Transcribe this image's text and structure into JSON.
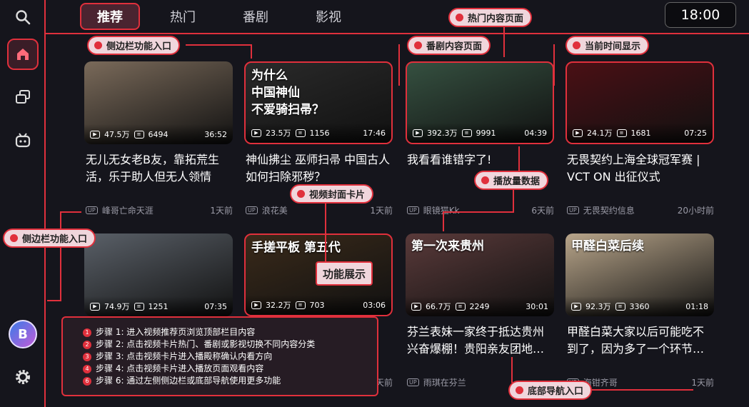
{
  "tabs": [
    "推荐",
    "热门",
    "番剧",
    "影视"
  ],
  "clock": "18:00",
  "sidebar": {
    "icons": [
      "search-icon",
      "home-icon",
      "library-icon",
      "tv-icon",
      "settings-icon"
    ],
    "avatar_letter": "B"
  },
  "cards": [
    {
      "views": "47.5万",
      "danmaku": "6494",
      "duration": "36:52",
      "title": "无儿无女老B友，靠拓荒生活，乐于助人但无人领情",
      "up": "UP",
      "author": "峰哥亡命天涯",
      "time": "1天前",
      "overlay": "",
      "thumb_color": "#7a6a5a"
    },
    {
      "views": "23.5万",
      "danmaku": "1156",
      "duration": "17:46",
      "title": "神仙拂尘 巫师扫帚 中国古人如何扫除邪秽？",
      "up": "UP",
      "author": "浪花美",
      "time": "1天前",
      "overlay": "为什么\n中国神仙\n不爱骑扫帚？",
      "thumb_color": "#2a2a2a"
    },
    {
      "views": "392.3万",
      "danmaku": "9991",
      "duration": "04:39",
      "title": "我看看谁错字了!",
      "up": "UP",
      "author": "眼镜猫Kk",
      "time": "6天前",
      "overlay": "",
      "thumb_color": "#355040"
    },
    {
      "views": "24.1万",
      "danmaku": "1681",
      "duration": "07:25",
      "title": "无畏契约上海全球冠军赛 | VCT ON 出征仪式",
      "up": "UP",
      "author": "无畏契约信息",
      "time": "20小时前",
      "overlay": "",
      "thumb_color": "#4a1015"
    },
    {
      "views": "74.9万",
      "danmaku": "1251",
      "duration": "07:35",
      "title": "",
      "up": "UP",
      "author": "",
      "time": "",
      "overlay": "",
      "thumb_color": "#5a6068"
    },
    {
      "views": "32.2万",
      "danmaku": "703",
      "duration": "03:06",
      "title": "",
      "up": "UP",
      "author": "",
      "time": "1天前",
      "overlay": "手搓平板 第五代",
      "thumb_color": "#3a2a1a"
    },
    {
      "views": "66.7万",
      "danmaku": "2249",
      "duration": "30:01",
      "title": "芬兰表妹一家终于抵达贵州兴奋爆棚！贵阳亲友团地…",
      "up": "UP",
      "author": "雨琪在芬兰",
      "time": "",
      "overlay": "第一次来贵州",
      "thumb_color": "#5a3a3a"
    },
    {
      "views": "92.3万",
      "danmaku": "3360",
      "duration": "01:18",
      "title": "甲醛白菜大家以后可能吃不到了，因为多了一个环节…",
      "up": "UP",
      "author": "海钳齐哥",
      "time": "1天前",
      "overlay": "甲醛白菜后续",
      "thumb_color": "#b8a58a"
    }
  ],
  "callouts": {
    "sidebar_entry_top": "侧边栏功能入口",
    "sidebar_entry_left": "侧边栏功能入口",
    "hot_page": "热门内容页面",
    "anime_page": "番剧内容页面",
    "current_time": "当前时间显示",
    "play_count": "播放量数据",
    "cover_card": "视频封面卡片",
    "bottom_nav": "底部导航入口",
    "feature_demo": "功能展示"
  },
  "steps": [
    "步骤 1: 进入视频推荐页浏览顶部栏目内容",
    "步骤 2: 点击视频卡片热门、番剧或影视切换不同内容分类",
    "步骤 3: 点击视频卡片进入播殿称确认内看方向",
    "步骤 4: 点击视频卡片进入播放页面观看内容",
    "步骤 6: 通过左侧侧边栏或底部导航使用更多功能"
  ],
  "colors": {
    "accent": "#e0303c",
    "background": "#15151c",
    "callout_bg": "#f0d6dc"
  }
}
